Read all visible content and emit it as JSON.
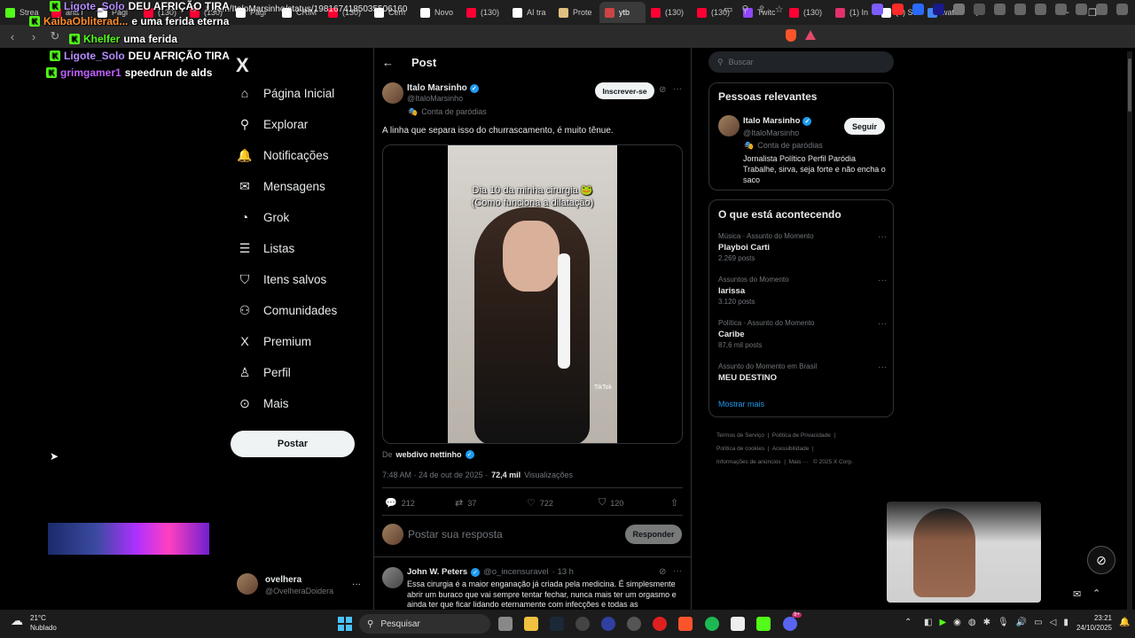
{
  "browser": {
    "tabs": [
      {
        "label": "Strea",
        "color": "#53fc18"
      },
      {
        "label": "ana i",
        "color": "#ff0033"
      },
      {
        "label": "Pági",
        "color": "#ffffff"
      },
      {
        "label": "(130)",
        "color": "#ff0033"
      },
      {
        "label": "(130)",
        "color": "#ff0033"
      },
      {
        "label": "Pági",
        "color": "#ffffff"
      },
      {
        "label": "CRIM",
        "color": "#ffffff"
      },
      {
        "label": "(130)",
        "color": "#ff0033"
      },
      {
        "label": "Cem",
        "color": "#ffffff"
      },
      {
        "label": "Novo",
        "color": "#ffffff"
      },
      {
        "label": "(130)",
        "color": "#ff0033"
      },
      {
        "label": "AI tra",
        "color": "#ffffff"
      },
      {
        "label": "Prote",
        "color": "#e0c080"
      },
      {
        "label": "ytb",
        "color": "#cc4444",
        "active": true
      },
      {
        "label": "(130)",
        "color": "#ff0033"
      },
      {
        "label": "(130)",
        "color": "#ff0033"
      },
      {
        "label": "Twitc",
        "color": "#9146ff"
      },
      {
        "label": "(130)",
        "color": "#ff0033"
      },
      {
        "label": "(1) In",
        "color": "#e1306c"
      },
      {
        "label": "(7) Su",
        "color": "#ffffff"
      },
      {
        "label": "wate",
        "color": "#4285f4"
      }
    ],
    "new_tab": "+",
    "url": "x.com/ItaloMarsinho/status/1981674185035506160",
    "window_controls": {
      "minimize": "—",
      "maximize": "❐",
      "close": "✕"
    }
  },
  "chat_overlay": [
    {
      "user": "Ligote_Solo",
      "user_color": "#b48cff",
      "msg": "DEU AFRIÇÃO TIRA"
    },
    {
      "user": "KaibaObliterad...",
      "user_color": "#ff8c2a",
      "msg": "e uma ferida eterna"
    },
    {
      "user": "Khelfer",
      "user_color": "#53fc18",
      "msg": "uma ferida"
    },
    {
      "user": "Ligote_Solo",
      "user_color": "#b48cff",
      "msg": "DEU AFRIÇÃO TIRA"
    },
    {
      "user": "grimgamer1",
      "user_color": "#c060ff",
      "msg": "speedrun de alds"
    }
  ],
  "sidebar": {
    "logo": "X",
    "items": [
      {
        "label": "Página Inicial",
        "icon": "home-icon",
        "glyph": "⌂"
      },
      {
        "label": "Explorar",
        "icon": "search-icon",
        "glyph": "⚲"
      },
      {
        "label": "Notificações",
        "icon": "bell-icon",
        "glyph": "🔔"
      },
      {
        "label": "Mensagens",
        "icon": "mail-icon",
        "glyph": "✉"
      },
      {
        "label": "Grok",
        "icon": "grok-icon",
        "glyph": "◔"
      },
      {
        "label": "Listas",
        "icon": "list-icon",
        "glyph": "☰"
      },
      {
        "label": "Itens salvos",
        "icon": "bookmark-icon",
        "glyph": "⛉"
      },
      {
        "label": "Comunidades",
        "icon": "people-icon",
        "glyph": "⚇"
      },
      {
        "label": "Premium",
        "icon": "x-premium-icon",
        "glyph": "X"
      },
      {
        "label": "Perfil",
        "icon": "profile-icon",
        "glyph": "♙"
      },
      {
        "label": "Mais",
        "icon": "more-circle-icon",
        "glyph": "⊙"
      }
    ],
    "post_button": "Postar",
    "account": {
      "name": "ovelhera",
      "handle": "@OvelheraDoidera"
    }
  },
  "post": {
    "header_title": "Post",
    "author_name": "Italo Marsinho",
    "author_handle": "@ItaloMarsinho",
    "parody_label": "Conta de paródias",
    "subscribe_button": "Inscrever-se",
    "text": "A linha que separa isso do churrascamento, é muito tênue.",
    "video_caption_line1": "Dia 10 da minha cirurgia 🐸",
    "video_caption_line2": "(Como funciona a dilatação)",
    "video_watermark": "TikTok",
    "from_prefix": "De",
    "from_account": "webdivo nettinho",
    "timestamp": "7:48 AM · 24 de out de 2025 ·",
    "views_value": "72,4 mil",
    "views_label": "Visualizações",
    "stats": {
      "replies": "212",
      "reposts": "37",
      "likes": "722",
      "bookmarks": "120"
    },
    "reply_placeholder": "Postar sua resposta",
    "reply_button": "Responder"
  },
  "reply": {
    "author_name": "John W. Peters",
    "author_handle": "@o_incensuravel",
    "time": "· 13 h",
    "text": "Essa cirurgia é a maior enganação já criada pela medicina. É simplesmente abrir um buraco que vai sempre tentar fechar, nunca mais ter um orgasmo e ainda ter que ficar lidando eternamente com infecções e todas as"
  },
  "right": {
    "search_placeholder": "Buscar",
    "relevant": {
      "title": "Pessoas relevantes",
      "name": "Italo Marsinho",
      "handle": "@ItaloMarsinho",
      "parody_label": "Conta de paródias",
      "bio": "Jornalista Político Perfil Paródia Trabalhe, sirva, seja forte e não encha o saco",
      "follow_button": "Seguir"
    },
    "trends": {
      "title": "O que está acontecendo",
      "items": [
        {
          "meta": "Música · Assunto do Momento",
          "name": "Playboi Carti",
          "count": "2.269 posts"
        },
        {
          "meta": "Assuntos do Momento",
          "name": "larissa",
          "count": "3.120 posts"
        },
        {
          "meta": "Política · Assunto do Momento",
          "name": "Caribe",
          "count": "87,6 mil posts"
        },
        {
          "meta": "Assunto do Momento em Brasil",
          "name": "MEU DESTINO",
          "count": ""
        }
      ],
      "show_more": "Mostrar mais"
    },
    "footer": {
      "terms": "Termos de Serviço",
      "privacy": "Política de Privacidade",
      "cookies": "Política de cookies",
      "accessibility": "Acessibilidade",
      "ads": "Informações de anúncios",
      "more": "Mais ···",
      "copyright": "© 2025 X Corp."
    }
  },
  "taskbar": {
    "weather_temp": "21°C",
    "weather_desc": "Nublado",
    "search_label": "Pesquisar",
    "time": "23:21",
    "date": "24/10/2025",
    "discord_badge": "9+"
  }
}
